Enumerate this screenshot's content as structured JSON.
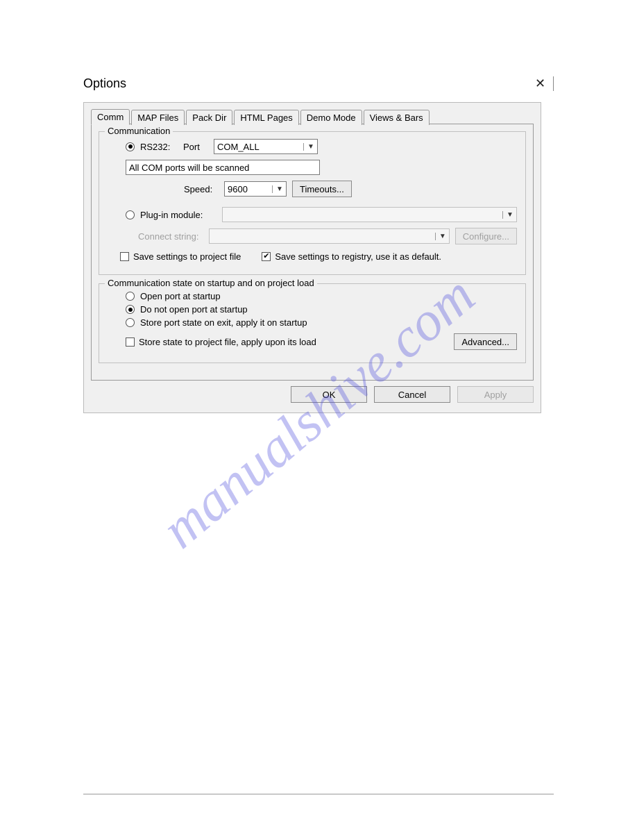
{
  "window": {
    "title": "Options"
  },
  "tabs": [
    "Comm",
    "MAP Files",
    "Pack Dir",
    "HTML Pages",
    "Demo Mode",
    "Views & Bars"
  ],
  "active_tab": 0,
  "group_comm": {
    "title": "Communication",
    "radio_rs232": "RS232:",
    "label_port": "Port",
    "port_value": "COM_ALL",
    "port_desc": "All COM ports will be scanned",
    "label_speed": "Speed:",
    "speed_value": "9600",
    "btn_timeouts": "Timeouts...",
    "radio_plugin": "Plug-in module:",
    "plugin_value": "",
    "label_connect": "Connect string:",
    "connect_value": "",
    "btn_configure": "Configure...",
    "chk_save_project": "Save settings to project file",
    "chk_save_registry": "Save settings to registry, use it as default."
  },
  "group_state": {
    "title": "Communication state on startup and on project load",
    "r_open": "Open port at startup",
    "r_dont": "Do not open port at startup",
    "r_store": "Store port state on exit, apply it on startup",
    "chk_store_proj": "Store state to project file, apply upon its load",
    "btn_advanced": "Advanced..."
  },
  "buttons": {
    "ok": "OK",
    "cancel": "Cancel",
    "apply": "Apply"
  },
  "watermark": "manualshive.com"
}
